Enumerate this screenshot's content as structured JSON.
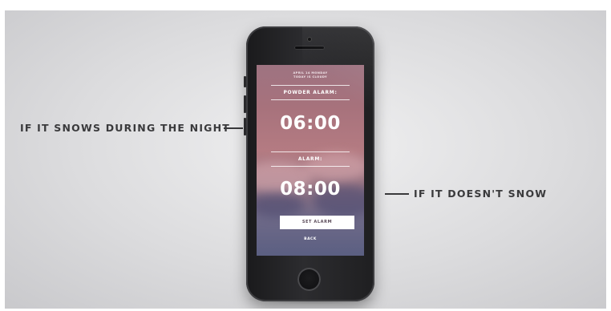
{
  "captions": {
    "left": "IF IT SNOWS DURING THE NIGHT",
    "right": "IF IT DOESN'T SNOW"
  },
  "screen": {
    "header_line1": "APRIL 14 MONDAY",
    "header_line2": "TODAY IS CLOUDY",
    "powder_alarm_label": "POWDER ALARM:",
    "powder_alarm_time": "06:00",
    "alarm_label": "ALARM:",
    "alarm_time": "08:00",
    "set_alarm_label": "SET ALARM",
    "back_label": "BACK"
  },
  "colors": {
    "background": "#dcdcde",
    "caption_text": "#3a3a3c",
    "screen_top": "#9e7381",
    "screen_bottom": "#5b5f82",
    "button_bg": "#ffffff"
  },
  "icons": {
    "phone_camera": "camera-icon",
    "phone_speaker": "speaker-icon",
    "home_button": "home-button-icon"
  }
}
